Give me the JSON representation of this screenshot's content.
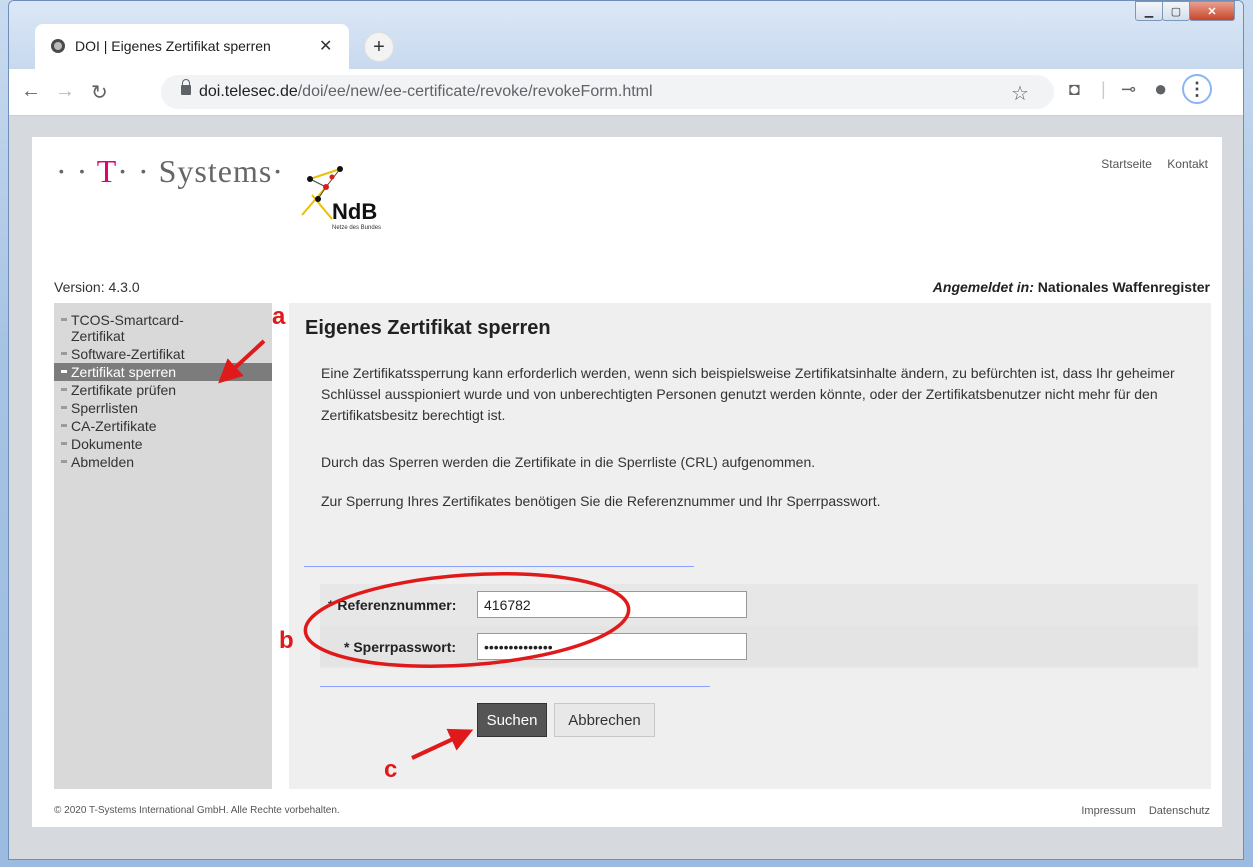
{
  "browser": {
    "tab_title": "DOI | Eigenes Zertifikat sperren",
    "url_host": "doi.telesec.de",
    "url_path": "/doi/ee/new/ee-certificate/revoke/revokeForm.html"
  },
  "header": {
    "logo_text_prefix": "· · ",
    "logo_text_t": "T",
    "logo_text_suffix": "· · Systems·",
    "ndb_title": "NdB",
    "ndb_subtitle": "Netze des Bundes",
    "links": [
      "Startseite",
      "Kontakt"
    ],
    "version": "Version: 4.3.0",
    "logged_in_label": "Angemeldet in:",
    "logged_in_value": "Nationales Waffenregister"
  },
  "sidebar": {
    "items": [
      {
        "label": "TCOS-Smartcard-Zertifikat"
      },
      {
        "label": "Software-Zertifikat"
      },
      {
        "label": "Zertifikat sperren",
        "active": true
      },
      {
        "label": "Zertifikate prüfen"
      },
      {
        "label": "Sperrlisten"
      },
      {
        "label": "CA-Zertifikate"
      },
      {
        "label": "Dokumente"
      },
      {
        "label": "Abmelden"
      }
    ]
  },
  "main": {
    "title": "Eigenes Zertifikat sperren",
    "paragraph1": "Eine Zertifikatssperrung kann erforderlich werden, wenn sich beispielsweise Zertifikatsinhalte ändern, zu befürchten ist, dass Ihr geheimer Schlüssel ausspioniert wurde und von unberechtigten Personen genutzt werden könnte, oder der Zertifikatsbenutzer nicht mehr für den Zertifikatsbesitz berechtigt ist.",
    "paragraph2": "Durch das Sperren werden die Zertifikate in die Sperrliste (CRL) aufgenommen.",
    "paragraph3": "Zur Sperrung Ihres Zertifikates benötigen Sie die Referenznummer und Ihr Sperrpasswort.",
    "form": {
      "ref_label": "* Referenznummer:",
      "ref_value": "416782",
      "pw_label": "* Sperrpasswort:",
      "pw_value": "••••••••••••••"
    },
    "buttons": {
      "search": "Suchen",
      "cancel": "Abbrechen"
    }
  },
  "footer": {
    "copyright": "© 2020 T-Systems International GmbH. Alle Rechte vorbehalten.",
    "links": [
      "Impressum",
      "Datenschutz"
    ]
  },
  "annotations": {
    "a": "a",
    "b": "b",
    "c": "c",
    "color": "#e01a1a"
  },
  "colors": {
    "brand_magenta": "#e20074",
    "active_nav": "#7c7c7c",
    "primary_button": "#555555"
  }
}
